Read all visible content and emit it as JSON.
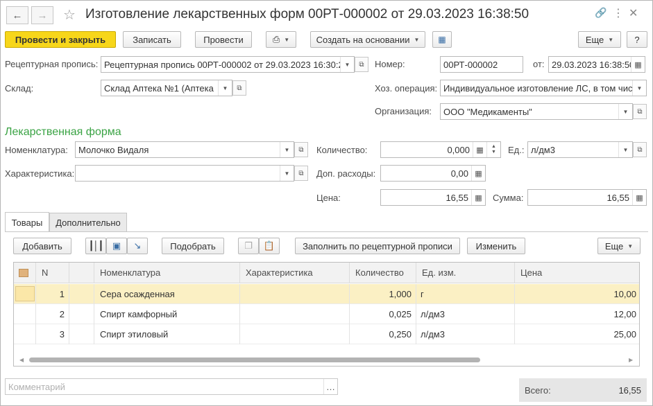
{
  "window": {
    "title": "Изготовление лекарственных форм 00РТ-000002 от 29.03.2023 16:38:50"
  },
  "toolbar": {
    "post_close": "Провести и закрыть",
    "save": "Записать",
    "post": "Провести",
    "create_based": "Создать на основании",
    "more": "Еще",
    "help": "?"
  },
  "header": {
    "recipe_label": "Рецептурная пропись:",
    "recipe_value": "Рецептурная пропись 00РТ-000002 от 29.03.2023 16:30:2",
    "number_label": "Номер:",
    "number_value": "00РТ-000002",
    "date_label": "от:",
    "date_value": "29.03.2023 16:38:50",
    "warehouse_label": "Склад:",
    "warehouse_value": "Склад Аптека №1 (Аптека",
    "operation_label": "Хоз. операция:",
    "operation_value": "Индивидуальное изготовление ЛС, в том чис",
    "org_label": "Организация:",
    "org_value": "ООО \"Медикаменты\""
  },
  "dosage_form": {
    "section_title": "Лекарственная форма",
    "nomenclature_label": "Номенклатура:",
    "nomenclature_value": "Молочко Видаля",
    "characteristic_label": "Характеристика:",
    "characteristic_value": "",
    "quantity_label": "Количество:",
    "quantity_value": "0,000",
    "unit_label": "Ед.:",
    "unit_value": "л/дм3",
    "extra_costs_label": "Доп. расходы:",
    "extra_costs_value": "0,00",
    "price_label": "Цена:",
    "price_value": "16,55",
    "sum_label": "Сумма:",
    "sum_value": "16,55"
  },
  "tabs": [
    {
      "label": "Товары"
    },
    {
      "label": "Дополнительно"
    }
  ],
  "table_toolbar": {
    "add": "Добавить",
    "pick": "Подобрать",
    "fill_recipe": "Заполнить по рецептурной прописи",
    "change": "Изменить",
    "more": "Еще"
  },
  "table": {
    "columns": [
      "N",
      "",
      "Номенклатура",
      "Характеристика",
      "Количество",
      "Ед. изм.",
      "Цена"
    ],
    "rows": [
      {
        "n": "1",
        "name": "Сера осажденная",
        "characteristic": "",
        "qty": "1,000",
        "unit": "г",
        "price": "10,00"
      },
      {
        "n": "2",
        "name": "Спирт камфорный",
        "characteristic": "",
        "qty": "0,025",
        "unit": "л/дм3",
        "price": "12,00"
      },
      {
        "n": "3",
        "name": "Спирт этиловый",
        "characteristic": "",
        "qty": "0,250",
        "unit": "л/дм3",
        "price": "25,00"
      }
    ]
  },
  "footer": {
    "comment_placeholder": "Комментарий",
    "total_label": "Всего:",
    "total_value": "16,55"
  },
  "colors": {
    "accent": "#f7d61a",
    "section": "#3aa344",
    "selected_row": "#fbf0c4"
  }
}
